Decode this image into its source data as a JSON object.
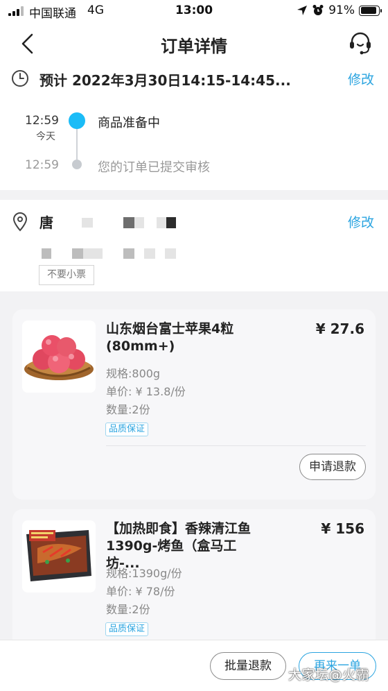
{
  "status_bar": {
    "carrier": "中国联通",
    "network": "4G",
    "time": "13:00",
    "battery": "91%",
    "battery_level": 0.91
  },
  "header": {
    "title": "订单详情",
    "icons": [
      "back-chevron-icon",
      "customer-service-headset-icon"
    ]
  },
  "delivery": {
    "eta": "预计 2022年3月30日14:15-14:45...",
    "edit_label": "修改",
    "timeline": [
      {
        "time": "12:59",
        "day": "今天",
        "status": "商品准备中",
        "active": true
      },
      {
        "time": "12:59",
        "status": "您的订单已提交审核",
        "active": false
      }
    ]
  },
  "address": {
    "name": "唐",
    "edit_label": "修改",
    "receipt_tag": "不要小票"
  },
  "items": [
    {
      "name": "山东烟台富士苹果4粒(80mm+)",
      "price": "¥ 27.6",
      "spec": "规格:800g",
      "unit_price": "单价: ¥ 13.8/份",
      "quantity": "数量:2份",
      "badge": "品质保证",
      "action": "申请退款"
    },
    {
      "name": "【加热即食】香辣清江鱼1390g-烤鱼（盒马工坊-...",
      "price": "¥ 156",
      "spec": "规格:1390g/份",
      "unit_price": "单价: ¥ 78/份",
      "quantity": "数量:2份",
      "badge": "品质保证"
    }
  ],
  "bottom_bar": {
    "batch_refund": "批量退款",
    "reorder": "再来一单",
    "watermark": "大家坛@火霸"
  },
  "colors": {
    "accent": "#2aa4e0",
    "timeline_active": "#1bbcf7",
    "section_bg": "#f2f2f4"
  }
}
